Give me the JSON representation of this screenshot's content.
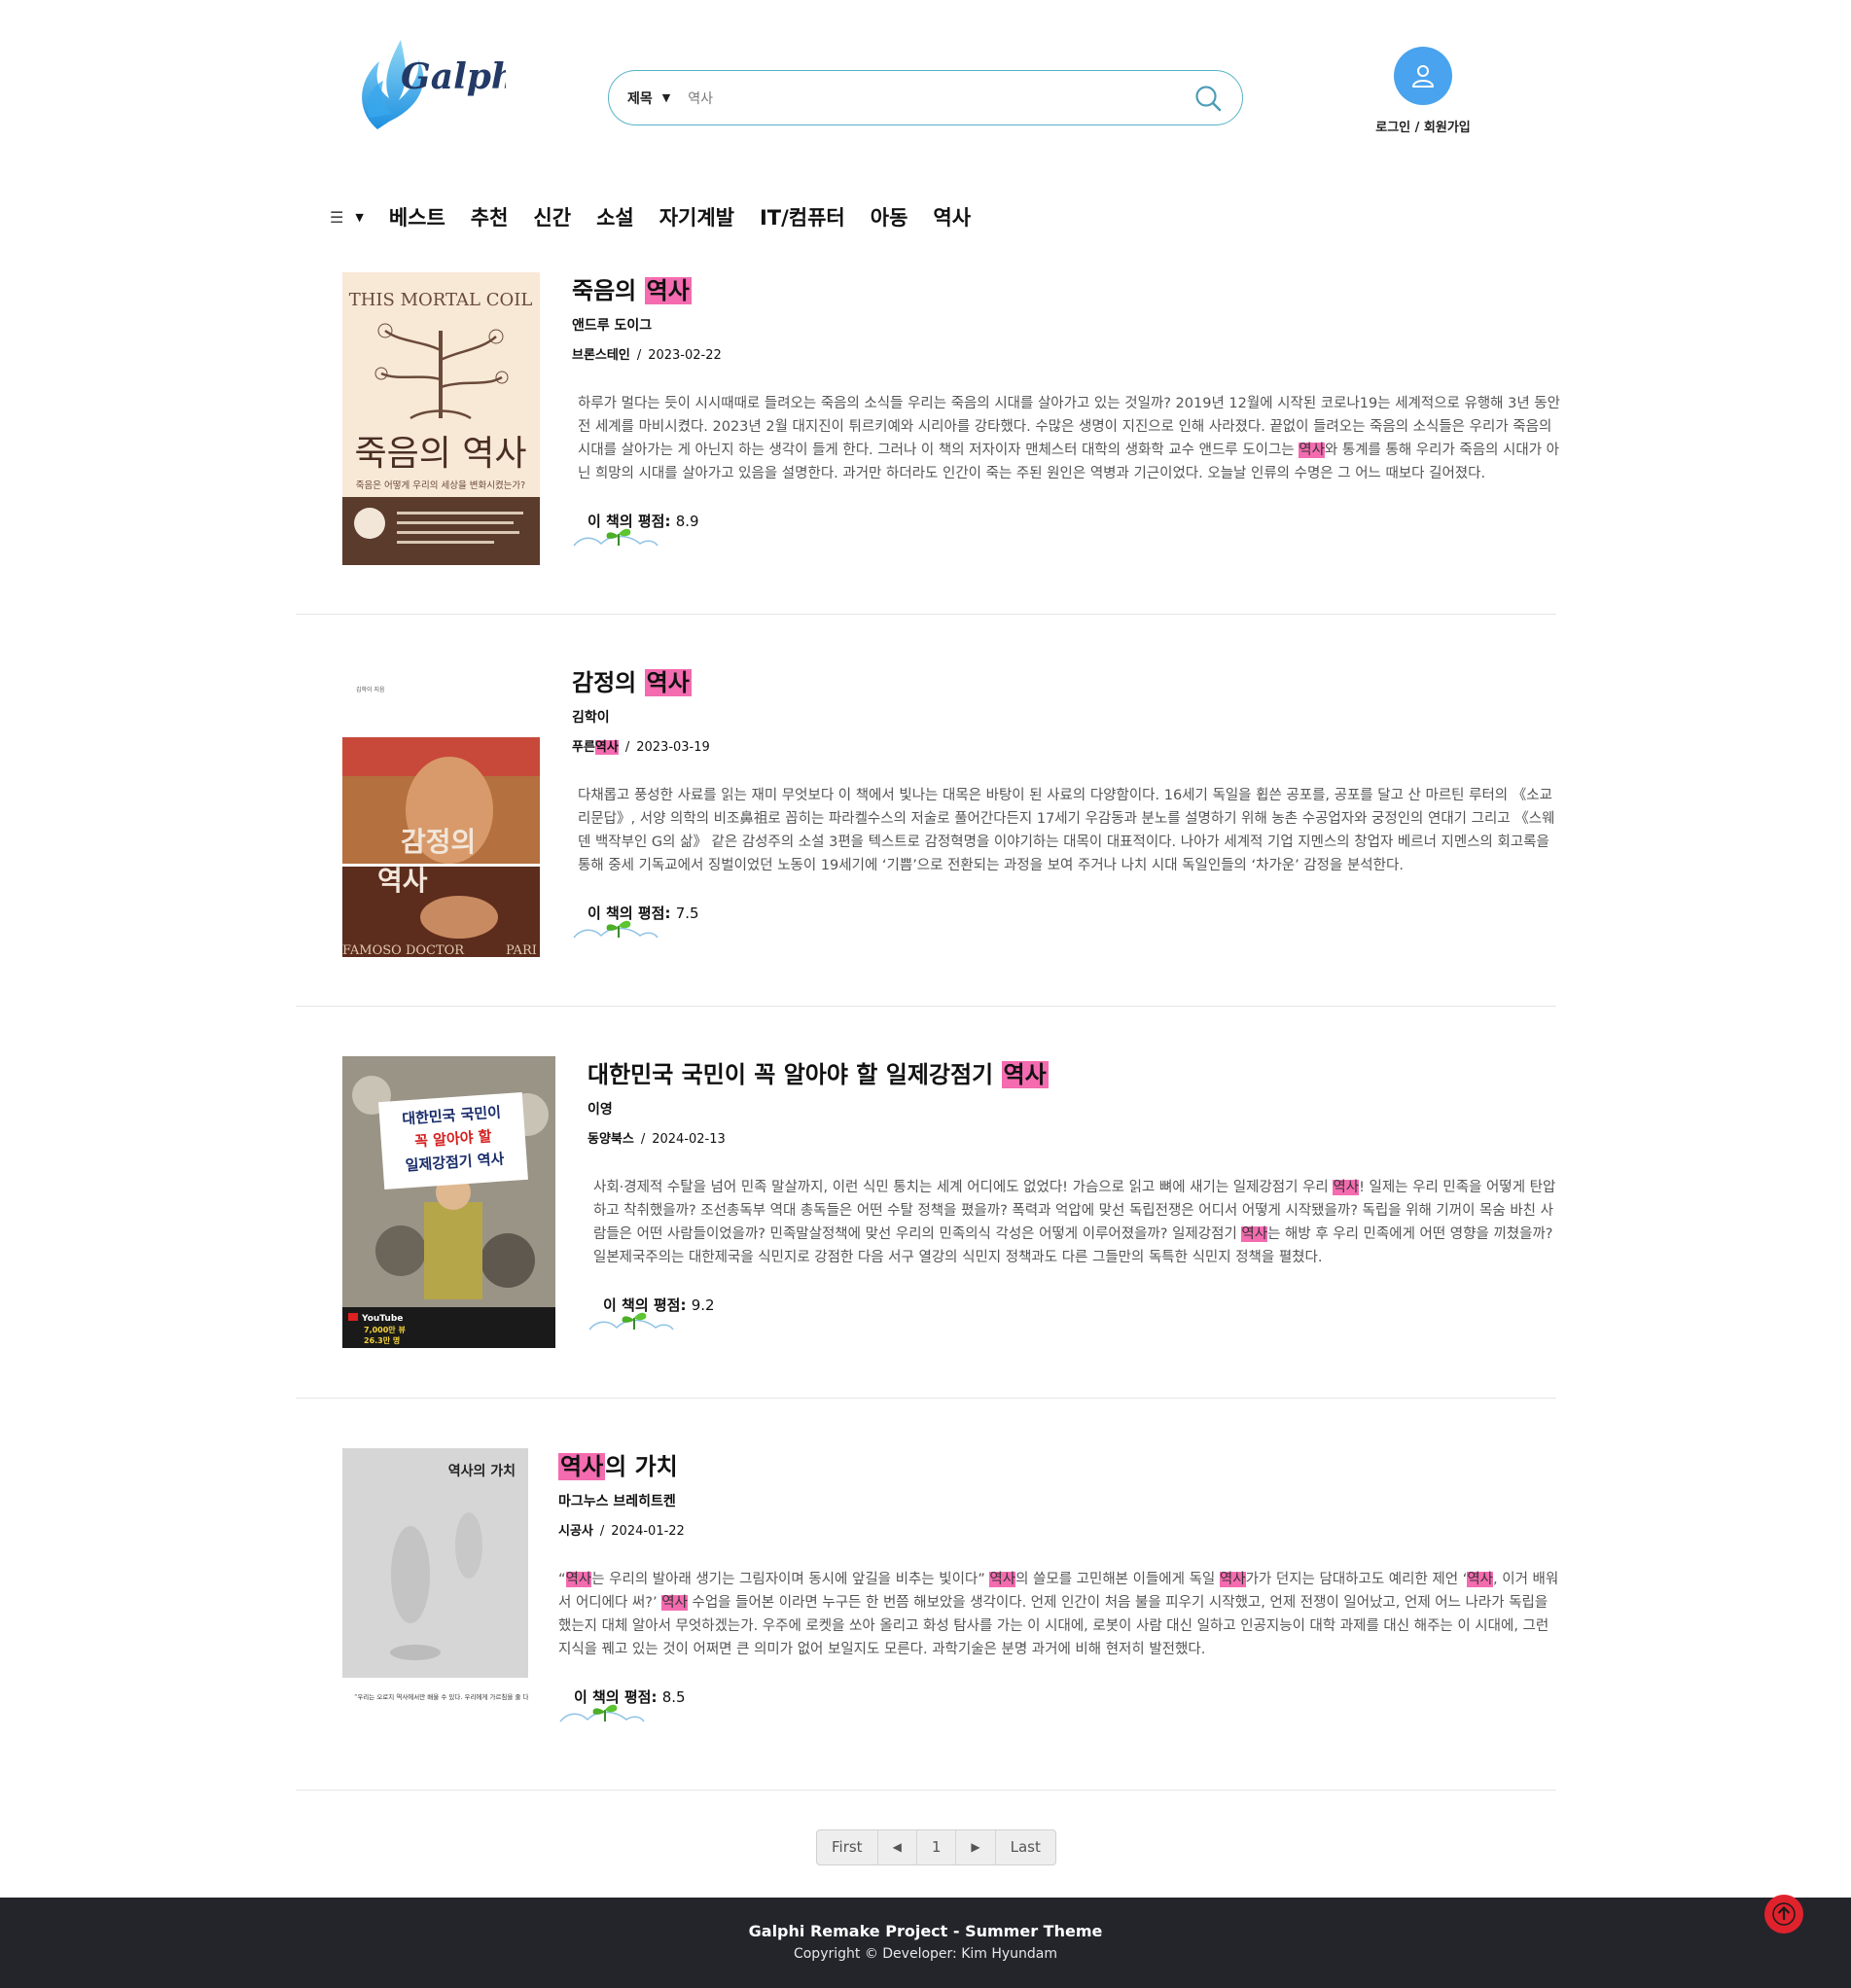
{
  "header": {
    "logo_text": "Galphi",
    "search": {
      "field_option": "제목",
      "query": "역사"
    },
    "user_label": "로그인 / 회원가입"
  },
  "nav": {
    "items": [
      "베스트",
      "추천",
      "신간",
      "소설",
      "자기계발",
      "IT/컴퓨터",
      "아동",
      "역사"
    ]
  },
  "books": [
    {
      "title_pre": "죽음의 ",
      "title_hl": "역사",
      "title_post": "",
      "author": "앤드루 도이그",
      "publisher_pre": "브론스테인",
      "publisher_hl": "",
      "publisher_post": "",
      "date": "2023-02-22",
      "desc": [
        {
          "t": "하루가 멀다는 듯이 시시때때로 들려오는 죽음의 소식들 우리는 죽음의 시대를 살아가고 있는 것일까? 2019년 12월에 시작된 코로나19는 세계적으로 유행해 3년 동안 전 세계를 마비시켰다. 2023년 2월 대지진이 튀르키예와 시리아를 강타했다. 수많은 생명이 지진으로 인해 사라졌다. 끝없이 들려오는 죽음의 소식들은 우리가 죽음의 시대를 살아가는 게 아닌지 하는 생각이 들게 한다. 그러나 이 책의 저자이자 맨체스터 대학의 생화학 교수 앤드루 도이그는 "
        },
        {
          "t": "역사",
          "hl": true
        },
        {
          "t": "와 통계를 통해 우리가 죽음의 시대가 아닌 희망의 시대를 살아가고 있음을 설명한다. 과거만 하더라도 인간이 죽는 주된 원인은 역병과 기근이었다. 오늘날 인류의 수명은 그 어느 때보다 길어졌다."
        }
      ],
      "rating_label": "이 책의 평점:",
      "rating": "8.9",
      "cover": {
        "top_text": "THIS MORTAL COIL",
        "main_title": "죽음의 역사",
        "subtitle": "죽음은 어떻게 우리의 세상을 변화시켰는가?"
      }
    },
    {
      "title_pre": "감정의 ",
      "title_hl": "역사",
      "title_post": "",
      "author": "김학이",
      "publisher_pre": "푸른",
      "publisher_hl": "역사",
      "publisher_post": "",
      "date": "2023-03-19",
      "desc": [
        {
          "t": "다채롭고 풍성한 사료를 읽는 재미 무엇보다 이 책에서 빛나는 대목은 바탕이 된 사료의 다양함이다. 16세기 독일을 휩쓴 공포를, 공포를 달고 산 마르틴 루터의 《소교리문답》, 서양 의학의 비조鼻祖로 꼽히는 파라켈수스의 저술로 풀어간다든지 17세기 우감동과 분노를 설명하기 위해 농촌 수공업자와 궁정인의 연대기 그리고 《스웨덴 백작부인 G의 삶》 같은 감성주의 소설 3편을 텍스트로 감정혁명을 이야기하는 대목이 대표적이다. 나아가 세계적 기업 지멘스의 창업자 베르너 지멘스의 회고록을 통해 중세 기독교에서 징벌이었던 노동이 19세기에 ‘기쁨’으로 전환되는 과정을 보여 주거나 나치 시대 독일인들의 ‘차가운’ 감정을 분석한다."
        }
      ],
      "rating_label": "이 책의 평점:",
      "rating": "7.5",
      "cover": {
        "author_line": "김학이 지음",
        "main_title_1": "감정의",
        "main_title_2": "역사",
        "caption": "FAMOSO DOCTOR",
        "caption_right": "PARI"
      }
    },
    {
      "title_pre": "대한민국 국민이 꼭 알아야 할 일제강점기 ",
      "title_hl": "역사",
      "title_post": "",
      "author": "이영",
      "publisher_pre": "동양북스",
      "publisher_hl": "",
      "publisher_post": "",
      "date": "2024-02-13",
      "desc": [
        {
          "t": "사회·경제적 수탈을 넘어 민족 말살까지, 이런 식민 통치는 세계 어디에도 없었다! 가슴으로 읽고 뼈에 새기는 일제강점기 우리 "
        },
        {
          "t": "역사",
          "hl": true
        },
        {
          "t": "! 일제는 우리 민족을 어떻게 탄압하고 착취했을까? 조선총독부 역대 총독들은 어떤 수탈 정책을 폈을까? 폭력과 억압에 맞선 독립전쟁은 어디서 어떻게 시작됐을까? 독립을 위해 기꺼이 목숨 바친 사람들은 어떤 사람들이었을까? 민족말살정책에 맞선 우리의 민족의식 각성은 어떻게 이루어졌을까? 일제강점기 "
        },
        {
          "t": "역사",
          "hl": true
        },
        {
          "t": "는 해방 후 우리 민족에게 어떤 영향을 끼쳤을까? 일본제국주의는 대한제국을 식민지로 강점한 다음 서구 열강의 식민지 정책과도 다른 그들만의 독특한 식민지 정책을 펼쳤다."
        }
      ],
      "rating_label": "이 책의 평점:",
      "rating": "9.2",
      "cover": {
        "title_1": "대한민국 국민이",
        "title_2": "꼭 알아야 할",
        "title_3": "일제강점기 역사",
        "youtube": "YouTube",
        "stat_1": "7,000만 뷰",
        "stat_2": "26.3만 명"
      }
    },
    {
      "title_pre": "",
      "title_hl": "역사",
      "title_post": "의 가치",
      "author": "마그누스 브레히트켄",
      "publisher_pre": "시공사",
      "publisher_hl": "",
      "publisher_post": "",
      "date": "2024-01-22",
      "desc": [
        {
          "t": "“"
        },
        {
          "t": "역사",
          "hl": true
        },
        {
          "t": "는 우리의 발아래 생기는 그림자이며 동시에 앞길을 비추는 빛이다” "
        },
        {
          "t": "역사",
          "hl": true
        },
        {
          "t": "의 쓸모를 고민해본 이들에게 독일 "
        },
        {
          "t": "역사",
          "hl": true
        },
        {
          "t": "가가 던지는 담대하고도 예리한 제언 ‘"
        },
        {
          "t": "역사",
          "hl": true
        },
        {
          "t": ", 이거 배워서 어디에다 써?’ "
        },
        {
          "t": "역사",
          "hl": true
        },
        {
          "t": " 수업을 들어본 이라면 누구든 한 번쯤 해보았을 생각이다. 언제 인간이 처음 불을 피우기 시작했고, 언제 전쟁이 일어났고, 언제 어느 나라가 독립을 했는지 대체 알아서 무엇하겠는가. 우주에 로켓을 쏘아 올리고 화성 탐사를 가는 이 시대에, 로봇이 사람 대신 일하고 인공지능이 대학 과제를 대신 해주는 이 시대에, 그런 지식을 꿰고 있는 것이 어쩌면 큰 의미가 없어 보일지도 모른다. 과학기술은 분명 과거에 비해 현저히 발전했다."
        }
      ],
      "rating_label": "이 책의 평점:",
      "rating": "8.5",
      "cover": {
        "title": "역사의 가치",
        "quote": "“우리는 오로지 역사에서만 배울 수 있다. 우리에게 가르침을 줄 다른 것은 존재하지 않는다”"
      }
    }
  ],
  "pagination": {
    "first": "First",
    "prev": "◀",
    "page": "1",
    "next": "▶",
    "last": "Last"
  },
  "footer": {
    "title": "Galphi Remake Project - Summer Theme",
    "copyright": "Copyright © Developer: Kim Hyundam"
  },
  "colors": {
    "highlight": "#f46bb0",
    "search_border": "#56b3c7",
    "user_avatar": "#4aa3ee",
    "footer_bg": "#23252b",
    "scroll_top": "#e0222d"
  },
  "icons": [
    "logo-icon",
    "chevron-down-icon",
    "search-icon",
    "user-icon",
    "hamburger-icon",
    "caret-down-icon",
    "sprout-icon",
    "arrow-up-icon"
  ]
}
